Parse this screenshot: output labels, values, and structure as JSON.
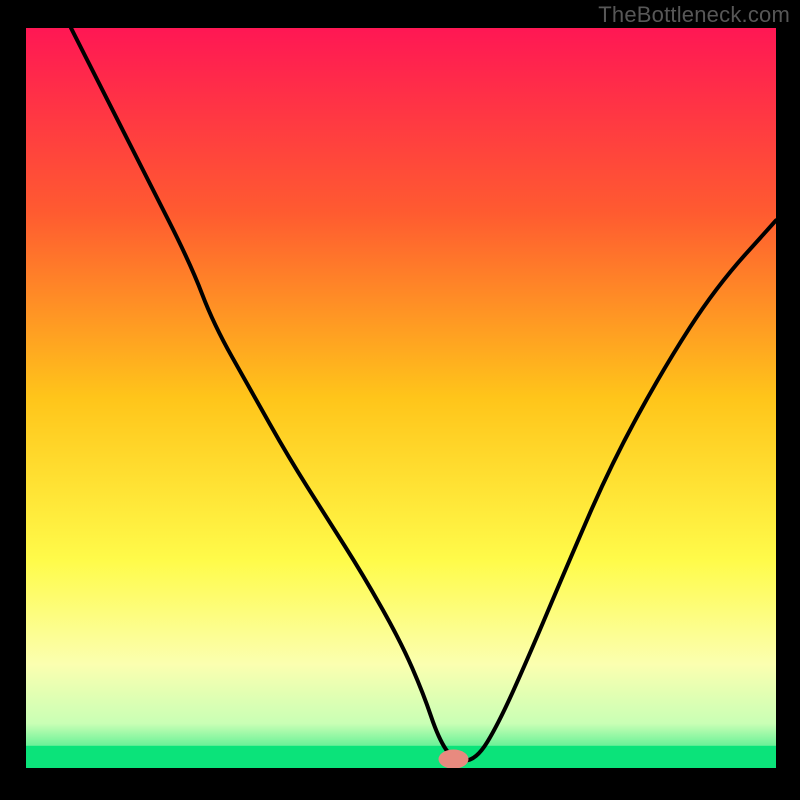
{
  "attribution": "TheBottleneck.com",
  "chart_data": {
    "type": "line",
    "title": "",
    "xlabel": "",
    "ylabel": "",
    "xlim": [
      0,
      100
    ],
    "ylim": [
      0,
      100
    ],
    "grid": false,
    "legend": false,
    "gradient_stops": [
      {
        "offset": 0,
        "color": "#ff1754"
      },
      {
        "offset": 25,
        "color": "#ff5b30"
      },
      {
        "offset": 50,
        "color": "#ffc51a"
      },
      {
        "offset": 72,
        "color": "#fffb4a"
      },
      {
        "offset": 86,
        "color": "#fbffb0"
      },
      {
        "offset": 94,
        "color": "#c9ffb5"
      },
      {
        "offset": 100,
        "color": "#0be37a"
      }
    ],
    "green_band_y": [
      0,
      3
    ],
    "marker": {
      "x": 57,
      "y": 1.2,
      "color": "#e88a7f",
      "rx": 2.0,
      "ry": 1.3
    },
    "series": [
      {
        "name": "bottleneck-curve",
        "x": [
          6,
          10,
          16,
          22,
          25,
          30,
          35,
          40,
          45,
          50,
          53,
          55,
          57,
          60,
          63,
          67,
          72,
          78,
          85,
          92,
          100
        ],
        "y": [
          100,
          92,
          80,
          68,
          60,
          51,
          42,
          34,
          26,
          17,
          10,
          4,
          1,
          1,
          6,
          15,
          27,
          41,
          54,
          65,
          74
        ]
      }
    ]
  }
}
